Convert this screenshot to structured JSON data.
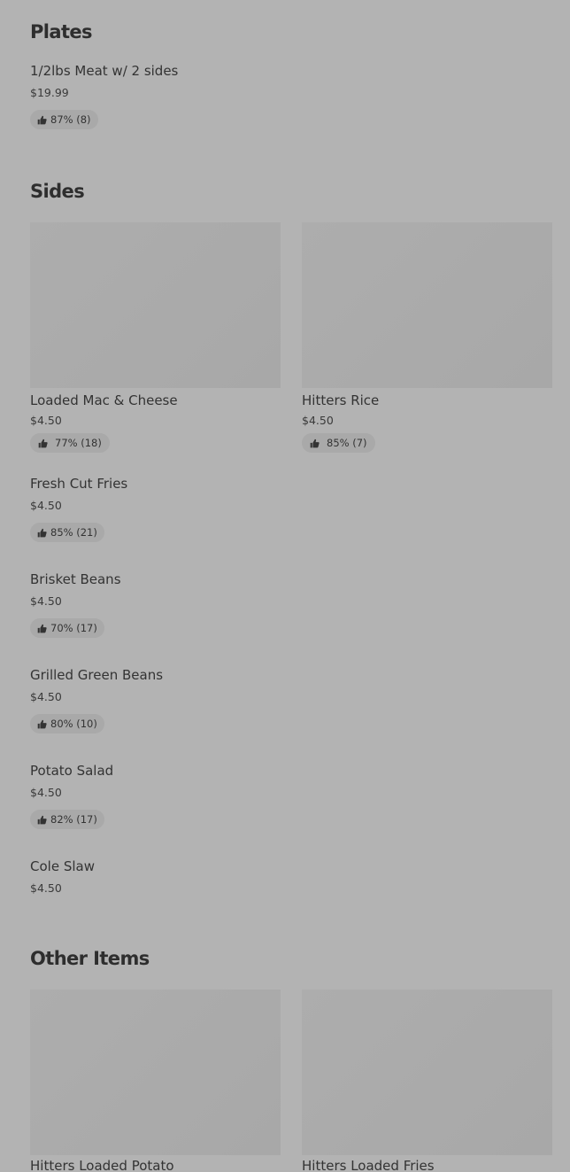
{
  "sections": {
    "plates": {
      "title": "Plates",
      "items": [
        {
          "name": "1/2lbs Meat w/ 2 sides",
          "price": "$19.99",
          "rating": "87% (8)"
        }
      ]
    },
    "sides": {
      "title": "Sides",
      "featured": [
        {
          "name": "Loaded Mac & Cheese",
          "price": "$4.50",
          "rating": "77% (18)"
        },
        {
          "name": "Hitters Rice",
          "price": "$4.50",
          "rating": "85% (7)"
        }
      ],
      "items": [
        {
          "name": "Fresh Cut Fries",
          "price": "$4.50",
          "rating": "85% (21)"
        },
        {
          "name": "Brisket Beans",
          "price": "$4.50",
          "rating": "70% (17)"
        },
        {
          "name": "Grilled Green Beans",
          "price": "$4.50",
          "rating": "80% (10)"
        },
        {
          "name": "Potato Salad",
          "price": "$4.50",
          "rating": "82% (17)"
        },
        {
          "name": "Cole Slaw",
          "price": "$4.50"
        }
      ]
    },
    "other": {
      "title": "Other Items",
      "featured": [
        {
          "name": "Hitters Loaded Potato"
        },
        {
          "name": "Hitters Loaded Fries"
        }
      ]
    }
  },
  "icons": {
    "rating": "thumbs-up-icon"
  },
  "colors": {
    "overlay_background": "#b3b3b3",
    "image_placeholder": "#aaaaaa",
    "rating_pill": "#a9a9a9",
    "text": "#333333"
  }
}
